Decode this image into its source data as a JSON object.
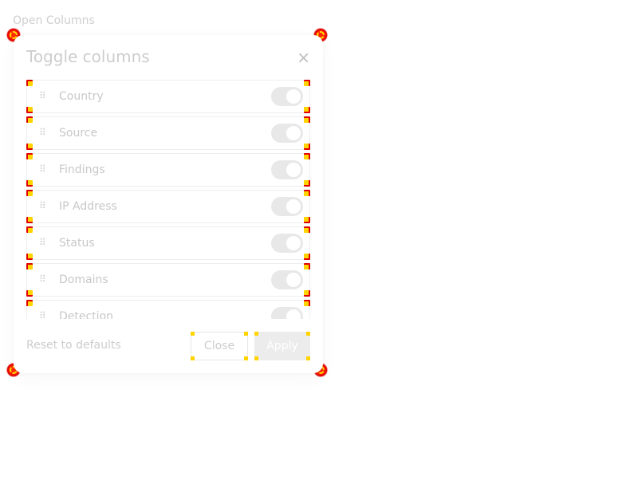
{
  "open_link": "Open Columns",
  "dialog": {
    "title": "Toggle columns",
    "close_glyph": "×",
    "columns": [
      {
        "label": "Country",
        "enabled": true
      },
      {
        "label": "Source",
        "enabled": true
      },
      {
        "label": "Findings",
        "enabled": true
      },
      {
        "label": "IP Address",
        "enabled": true
      },
      {
        "label": "Status",
        "enabled": true
      },
      {
        "label": "Domains",
        "enabled": true
      },
      {
        "label": "Detection",
        "enabled": true
      }
    ],
    "drag_glyph": "⠿",
    "reset_label": "Reset to defaults",
    "close_label": "Close",
    "apply_label": "Apply"
  },
  "colors": {
    "toggle_on": "#e8e8e8",
    "apply_bg": "#ececec",
    "highlight_red": "#e00000",
    "highlight_yellow": "#ffd400"
  }
}
